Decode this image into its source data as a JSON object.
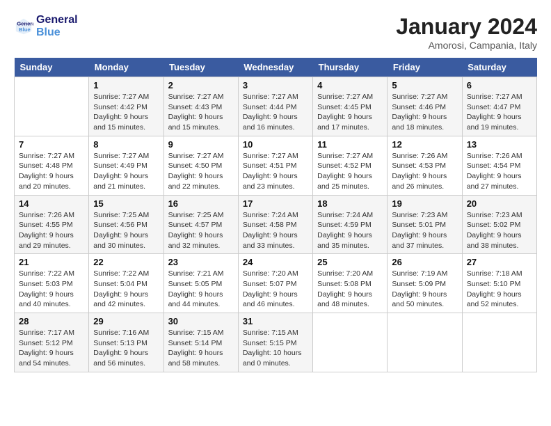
{
  "header": {
    "logo_line1": "General",
    "logo_line2": "Blue",
    "month_title": "January 2024",
    "subtitle": "Amorosi, Campania, Italy"
  },
  "days_of_week": [
    "Sunday",
    "Monday",
    "Tuesday",
    "Wednesday",
    "Thursday",
    "Friday",
    "Saturday"
  ],
  "weeks": [
    [
      {
        "day": "",
        "info": ""
      },
      {
        "day": "1",
        "info": "Sunrise: 7:27 AM\nSunset: 4:42 PM\nDaylight: 9 hours\nand 15 minutes."
      },
      {
        "day": "2",
        "info": "Sunrise: 7:27 AM\nSunset: 4:43 PM\nDaylight: 9 hours\nand 15 minutes."
      },
      {
        "day": "3",
        "info": "Sunrise: 7:27 AM\nSunset: 4:44 PM\nDaylight: 9 hours\nand 16 minutes."
      },
      {
        "day": "4",
        "info": "Sunrise: 7:27 AM\nSunset: 4:45 PM\nDaylight: 9 hours\nand 17 minutes."
      },
      {
        "day": "5",
        "info": "Sunrise: 7:27 AM\nSunset: 4:46 PM\nDaylight: 9 hours\nand 18 minutes."
      },
      {
        "day": "6",
        "info": "Sunrise: 7:27 AM\nSunset: 4:47 PM\nDaylight: 9 hours\nand 19 minutes."
      }
    ],
    [
      {
        "day": "7",
        "info": "Sunrise: 7:27 AM\nSunset: 4:48 PM\nDaylight: 9 hours\nand 20 minutes."
      },
      {
        "day": "8",
        "info": "Sunrise: 7:27 AM\nSunset: 4:49 PM\nDaylight: 9 hours\nand 21 minutes."
      },
      {
        "day": "9",
        "info": "Sunrise: 7:27 AM\nSunset: 4:50 PM\nDaylight: 9 hours\nand 22 minutes."
      },
      {
        "day": "10",
        "info": "Sunrise: 7:27 AM\nSunset: 4:51 PM\nDaylight: 9 hours\nand 23 minutes."
      },
      {
        "day": "11",
        "info": "Sunrise: 7:27 AM\nSunset: 4:52 PM\nDaylight: 9 hours\nand 25 minutes."
      },
      {
        "day": "12",
        "info": "Sunrise: 7:26 AM\nSunset: 4:53 PM\nDaylight: 9 hours\nand 26 minutes."
      },
      {
        "day": "13",
        "info": "Sunrise: 7:26 AM\nSunset: 4:54 PM\nDaylight: 9 hours\nand 27 minutes."
      }
    ],
    [
      {
        "day": "14",
        "info": "Sunrise: 7:26 AM\nSunset: 4:55 PM\nDaylight: 9 hours\nand 29 minutes."
      },
      {
        "day": "15",
        "info": "Sunrise: 7:25 AM\nSunset: 4:56 PM\nDaylight: 9 hours\nand 30 minutes."
      },
      {
        "day": "16",
        "info": "Sunrise: 7:25 AM\nSunset: 4:57 PM\nDaylight: 9 hours\nand 32 minutes."
      },
      {
        "day": "17",
        "info": "Sunrise: 7:24 AM\nSunset: 4:58 PM\nDaylight: 9 hours\nand 33 minutes."
      },
      {
        "day": "18",
        "info": "Sunrise: 7:24 AM\nSunset: 4:59 PM\nDaylight: 9 hours\nand 35 minutes."
      },
      {
        "day": "19",
        "info": "Sunrise: 7:23 AM\nSunset: 5:01 PM\nDaylight: 9 hours\nand 37 minutes."
      },
      {
        "day": "20",
        "info": "Sunrise: 7:23 AM\nSunset: 5:02 PM\nDaylight: 9 hours\nand 38 minutes."
      }
    ],
    [
      {
        "day": "21",
        "info": "Sunrise: 7:22 AM\nSunset: 5:03 PM\nDaylight: 9 hours\nand 40 minutes."
      },
      {
        "day": "22",
        "info": "Sunrise: 7:22 AM\nSunset: 5:04 PM\nDaylight: 9 hours\nand 42 minutes."
      },
      {
        "day": "23",
        "info": "Sunrise: 7:21 AM\nSunset: 5:05 PM\nDaylight: 9 hours\nand 44 minutes."
      },
      {
        "day": "24",
        "info": "Sunrise: 7:20 AM\nSunset: 5:07 PM\nDaylight: 9 hours\nand 46 minutes."
      },
      {
        "day": "25",
        "info": "Sunrise: 7:20 AM\nSunset: 5:08 PM\nDaylight: 9 hours\nand 48 minutes."
      },
      {
        "day": "26",
        "info": "Sunrise: 7:19 AM\nSunset: 5:09 PM\nDaylight: 9 hours\nand 50 minutes."
      },
      {
        "day": "27",
        "info": "Sunrise: 7:18 AM\nSunset: 5:10 PM\nDaylight: 9 hours\nand 52 minutes."
      }
    ],
    [
      {
        "day": "28",
        "info": "Sunrise: 7:17 AM\nSunset: 5:12 PM\nDaylight: 9 hours\nand 54 minutes."
      },
      {
        "day": "29",
        "info": "Sunrise: 7:16 AM\nSunset: 5:13 PM\nDaylight: 9 hours\nand 56 minutes."
      },
      {
        "day": "30",
        "info": "Sunrise: 7:15 AM\nSunset: 5:14 PM\nDaylight: 9 hours\nand 58 minutes."
      },
      {
        "day": "31",
        "info": "Sunrise: 7:15 AM\nSunset: 5:15 PM\nDaylight: 10 hours\nand 0 minutes."
      },
      {
        "day": "",
        "info": ""
      },
      {
        "day": "",
        "info": ""
      },
      {
        "day": "",
        "info": ""
      }
    ]
  ]
}
